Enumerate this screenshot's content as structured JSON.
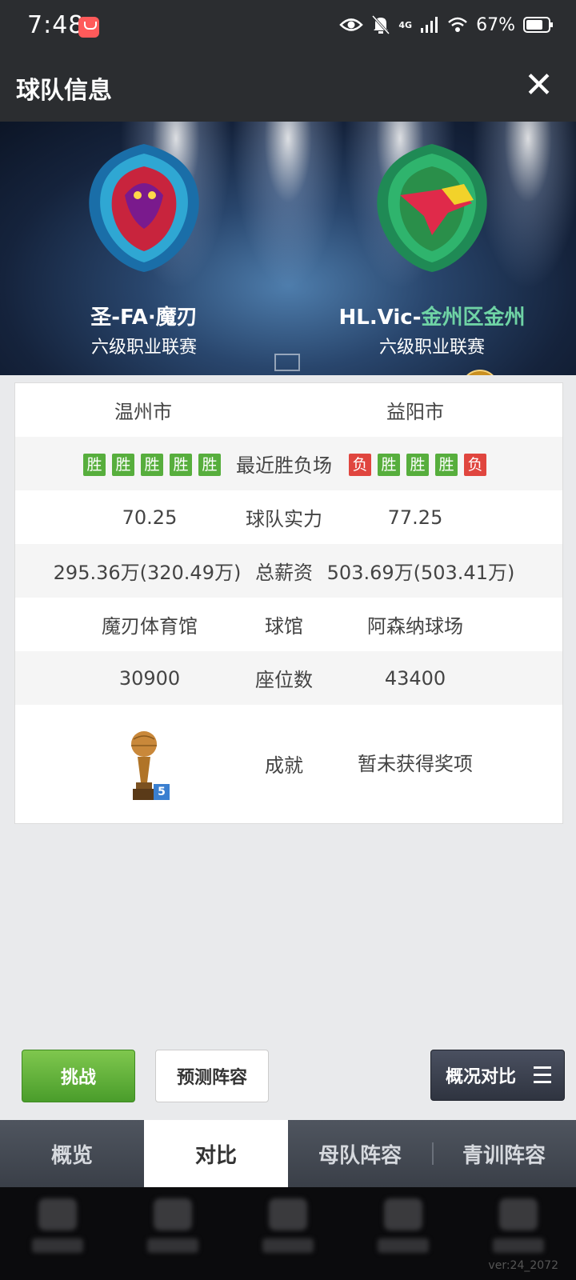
{
  "status_bar": {
    "time": "7:48",
    "network": "4G",
    "battery": "67%",
    "icons": [
      "eye-icon",
      "bell-off-icon",
      "signal-icon",
      "wifi-icon",
      "battery-icon"
    ]
  },
  "header": {
    "title": "球队信息",
    "close_icon": "close-icon"
  },
  "teams": {
    "home": {
      "name": "圣-FA·魔刃",
      "league": "六级职业联赛"
    },
    "away": {
      "name_prefix": "HL.Vic-",
      "name_highlight": "金州区金州",
      "league": "六级职业联赛"
    }
  },
  "comparison": {
    "city": {
      "home": "温州市",
      "away": "益阳市"
    },
    "recent": {
      "label": "最近胜负场",
      "home": [
        "胜",
        "胜",
        "胜",
        "胜",
        "胜"
      ],
      "away": [
        "负",
        "胜",
        "胜",
        "胜",
        "负"
      ]
    },
    "strength": {
      "label": "球队实力",
      "home": "70.25",
      "away": "77.25"
    },
    "salary": {
      "label": "总薪资",
      "home": "295.36万(320.49万)",
      "away": "503.69万(503.41万)"
    },
    "arena": {
      "label": "球馆",
      "home": "魔刃体育馆",
      "away": "阿森纳球场"
    },
    "seats": {
      "label": "座位数",
      "home": "30900",
      "away": "43400"
    },
    "achievements": {
      "label": "成就",
      "home_trophy_count": "5",
      "away": "暂未获得奖项"
    }
  },
  "actions": {
    "challenge": "挑战",
    "predict": "预测阵容",
    "compare": "概况对比"
  },
  "tabs": [
    {
      "label": "概览",
      "active": false
    },
    {
      "label": "对比",
      "active": true
    },
    {
      "label": "母队阵容",
      "active": false
    },
    {
      "label": "青训阵容",
      "active": false
    }
  ],
  "version": "ver:24_2072",
  "colors": {
    "win": "#57ae3d",
    "loss": "#e0463f",
    "accent": "#6fd3a5",
    "dark_bar": "#2b2d30"
  }
}
